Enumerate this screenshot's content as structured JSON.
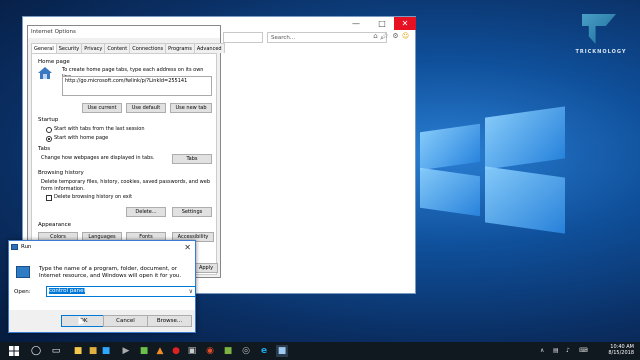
{
  "logo": {
    "text": "TRICKNOLOGY"
  },
  "browser": {
    "search_placeholder": "Search...",
    "min_glyph": "—",
    "max_glyph": "□",
    "close_glyph": "✕"
  },
  "internet_options": {
    "title": "Internet Options",
    "tabs": [
      "General",
      "Security",
      "Privacy",
      "Content",
      "Connections",
      "Programs",
      "Advanced"
    ],
    "home_page": {
      "heading": "Home page",
      "description": "To create home page tabs, type each address on its own line.",
      "url": "http://go.microsoft.com/fwlink/p/?LinkId=255141",
      "use_current": "Use current",
      "use_default": "Use default",
      "use_new_tab": "Use new tab"
    },
    "startup": {
      "heading": "Startup",
      "option_tabs": "Start with tabs from the last session",
      "option_home": "Start with home page",
      "selected": "Start with home page"
    },
    "tabs_section": {
      "heading": "Tabs",
      "description": "Change how webpages are displayed in tabs.",
      "button": "Tabs"
    },
    "history": {
      "heading": "Browsing history",
      "description": "Delete temporary files, history, cookies, saved passwords, and web form information.",
      "checkbox": "Delete browsing history on exit",
      "delete_button": "Delete...",
      "settings_button": "Settings"
    },
    "appearance": {
      "heading": "Appearance",
      "colors": "Colors",
      "languages": "Languages",
      "fonts": "Fonts",
      "accessibility": "Accessibility"
    },
    "apply_partial": "Apply"
  },
  "run": {
    "title": "Run",
    "description": "Type the name of a program, folder, document, or Internet resource, and Windows will open it for you.",
    "open_label": "Open:",
    "open_value": "control panel",
    "ok": "OK",
    "cancel": "Cancel",
    "browse": "Browse...",
    "close_glyph": "✕"
  },
  "taskbar": {
    "time": "10:40 AM",
    "date": "8/15/2018",
    "app_icons": [
      "windows-start",
      "search",
      "task-view",
      "file-explorer",
      "folder",
      "photoshop",
      "media-player",
      "task-manager",
      "vlc",
      "media-app",
      "terminal",
      "chrome",
      "android-studio",
      "steam",
      "internet-explorer",
      "active-app"
    ]
  },
  "colors": {
    "accent": "#0078d7",
    "close_red": "#e81123",
    "taskbar": "#101820"
  }
}
